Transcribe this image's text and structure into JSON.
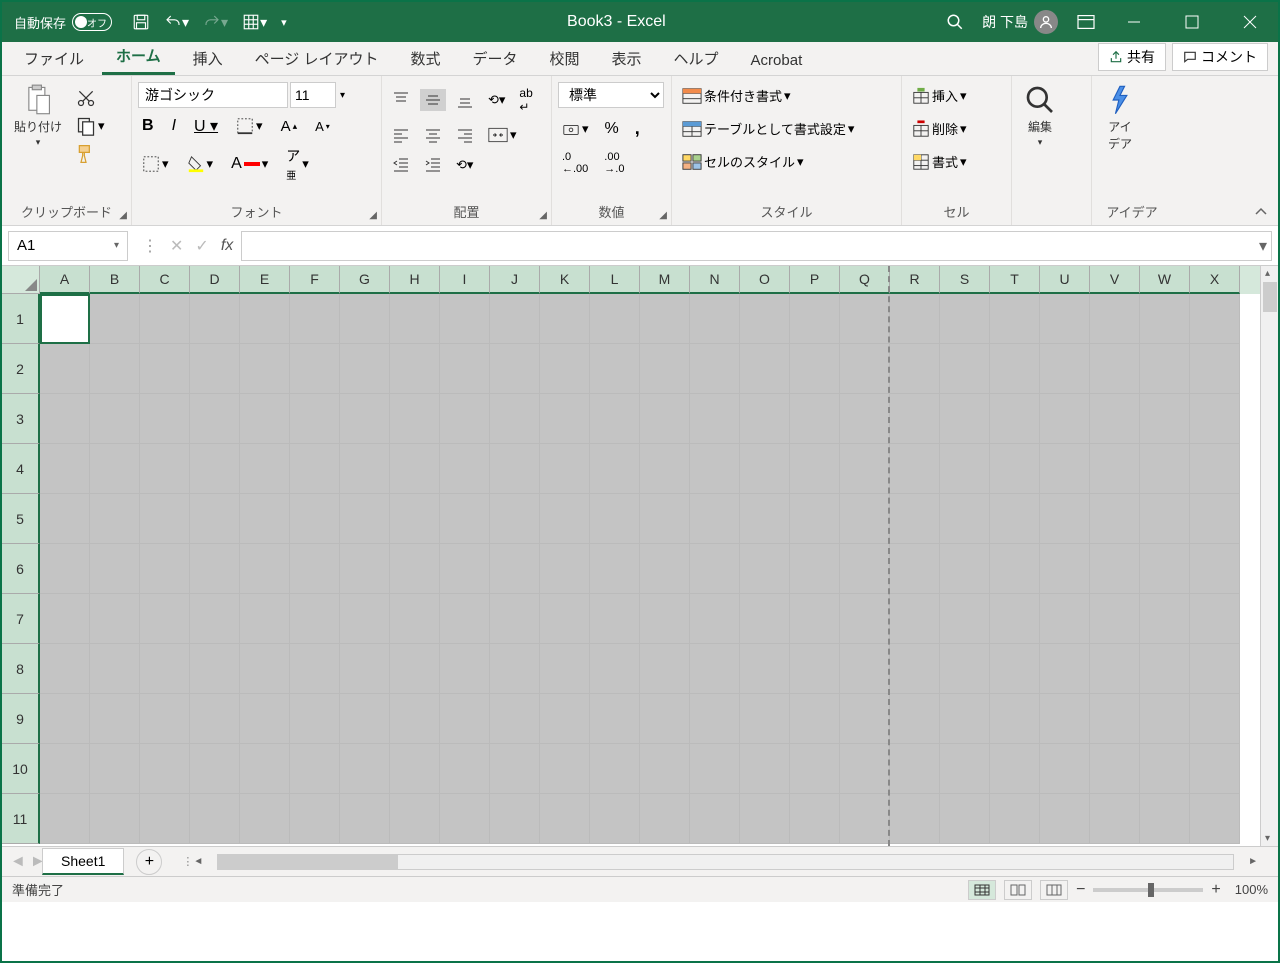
{
  "titlebar": {
    "autosave_label": "自動保存",
    "autosave_state": "オフ",
    "document_title": "Book3  -  Excel",
    "user_name": "朗 下島"
  },
  "tabs": {
    "items": [
      "ファイル",
      "ホーム",
      "挿入",
      "ページ レイアウト",
      "数式",
      "データ",
      "校閲",
      "表示",
      "ヘルプ",
      "Acrobat"
    ],
    "active_index": 1,
    "share": "共有",
    "comment": "コメント"
  },
  "ribbon": {
    "clipboard": {
      "label": "クリップボード",
      "paste": "貼り付け"
    },
    "font": {
      "label": "フォント",
      "name": "游ゴシック",
      "size": "11"
    },
    "alignment": {
      "label": "配置"
    },
    "number": {
      "label": "数値",
      "format": "標準"
    },
    "styles": {
      "label": "スタイル",
      "cond": "条件付き書式",
      "table": "テーブルとして書式設定",
      "cell": "セルのスタイル"
    },
    "cells": {
      "label": "セル",
      "insert": "挿入",
      "delete": "削除",
      "format": "書式"
    },
    "editing": {
      "label": "編集"
    },
    "ideas": {
      "label": "アイデア",
      "btn": "アイ\nデア"
    }
  },
  "namebox": {
    "value": "A1"
  },
  "grid": {
    "columns": [
      "A",
      "B",
      "C",
      "D",
      "E",
      "F",
      "G",
      "H",
      "I",
      "J",
      "K",
      "L",
      "M",
      "N",
      "O",
      "P",
      "Q",
      "R",
      "S",
      "T",
      "U",
      "V",
      "W",
      "X"
    ],
    "rows": [
      1,
      2,
      3,
      4,
      5,
      6,
      7,
      8,
      9,
      10,
      11
    ],
    "active_cell": "A1"
  },
  "sheets": {
    "active": "Sheet1"
  },
  "statusbar": {
    "ready": "準備完了",
    "zoom": "100%"
  }
}
